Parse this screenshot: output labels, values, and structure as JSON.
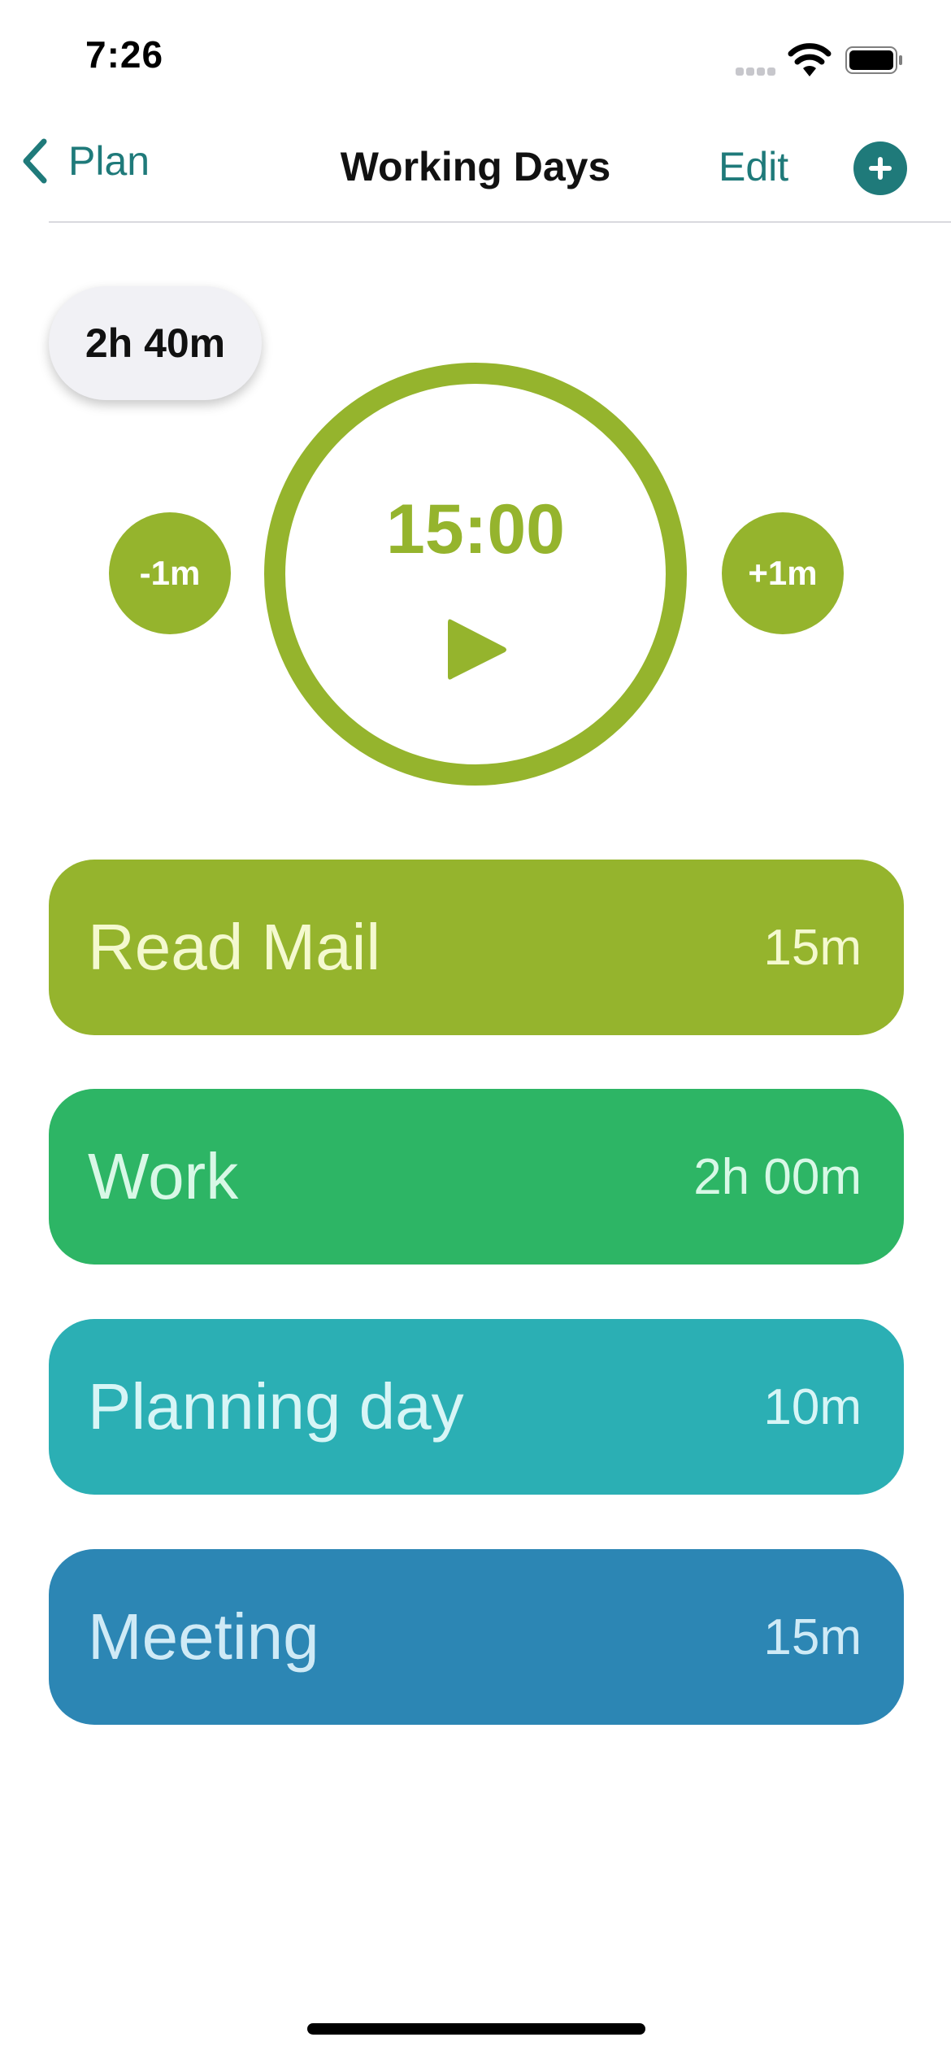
{
  "status_bar": {
    "time": "7:26"
  },
  "nav": {
    "back_label": "Plan",
    "title": "Working Days",
    "edit_label": "Edit",
    "add_icon": "plus-circle-icon",
    "accent_color": "#1f7a7a"
  },
  "total_duration": "2h 40m",
  "timer": {
    "display": "15:00",
    "minus_label": "-1m",
    "plus_label": "+1m",
    "play_icon": "play-icon",
    "color": "#95b42d"
  },
  "tasks": [
    {
      "name": "Read Mail",
      "duration": "15m",
      "color": "#95b42d"
    },
    {
      "name": "Work",
      "duration": "2h 00m",
      "color": "#2db565"
    },
    {
      "name": "Planning day",
      "duration": "10m",
      "color": "#2bafb4"
    },
    {
      "name": "Meeting",
      "duration": "15m",
      "color": "#2c86b4"
    }
  ]
}
